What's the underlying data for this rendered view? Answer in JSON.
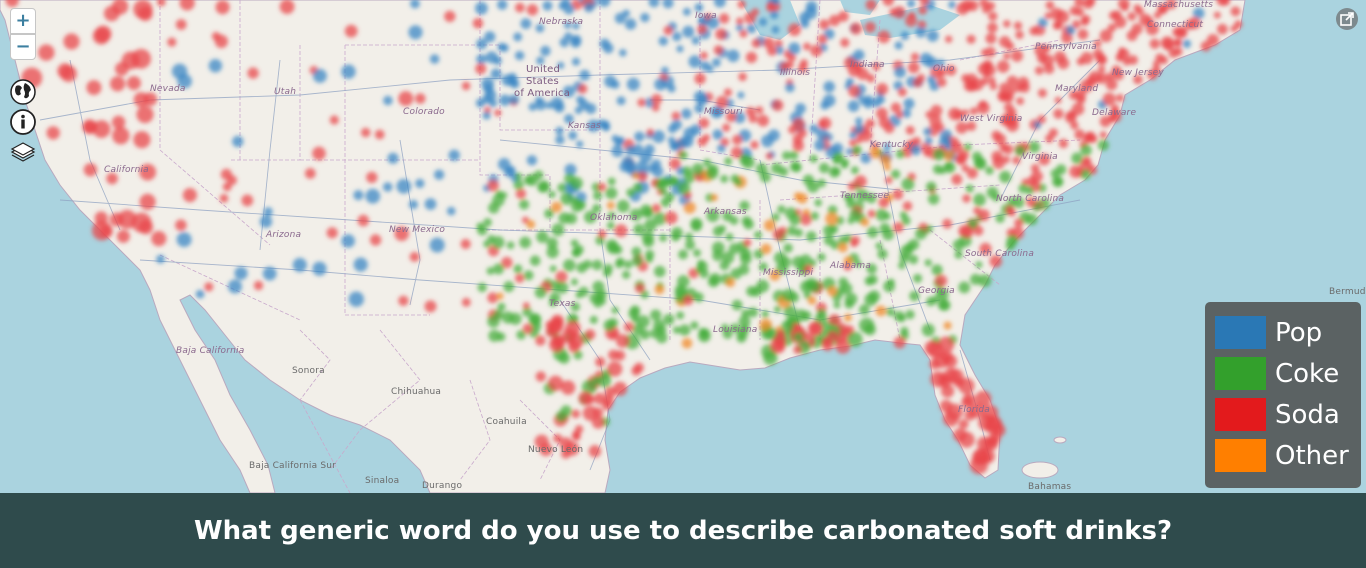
{
  "controls": {
    "zoom_in": "+",
    "zoom_out": "−"
  },
  "map_labels": {
    "nebraska": "Nebraska",
    "iowa": "Iowa",
    "massachusetts": "Massachusetts",
    "connecticut": "Connecticut",
    "nevada": "Nevada",
    "utah": "Utah",
    "usa_line1": "United",
    "usa_line2": "States",
    "usa_line3": "of America",
    "illinois": "Illinois",
    "indiana": "Indiana",
    "ohio": "Ohio",
    "pennsylvania": "Pennsylvania",
    "new_jersey": "New Jersey",
    "colorado": "Colorado",
    "kansas": "Kansas",
    "missouri": "Missouri",
    "maryland": "Maryland",
    "west_virginia": "West Virginia",
    "delaware": "Delaware",
    "california": "California",
    "kentucky": "Kentucky",
    "virginia": "Virginia",
    "tennessee": "Tennessee",
    "north_carolina": "North Carolina",
    "arkansas": "Arkansas",
    "oklahoma": "Oklahoma",
    "new_mexico": "New Mexico",
    "arizona": "Arizona",
    "south_carolina": "South Carolina",
    "mississippi": "Mississippi",
    "alabama": "Alabama",
    "georgia": "Georgia",
    "texas": "Texas",
    "louisiana": "Louisiana",
    "baja_california": "Baja California",
    "sonora": "Sonora",
    "chihuahua": "Chihuahua",
    "coahuila": "Coahuila",
    "nuevo_leon": "Nuevo León",
    "florida": "Florida",
    "baja_california_sur": "Baja California Sur",
    "sinaloa": "Sinaloa",
    "durango": "Durango",
    "bahamas": "Bahamas",
    "bermuda": "Bermud"
  },
  "legend": {
    "items": [
      {
        "label": "Pop",
        "color": "#2a78b5"
      },
      {
        "label": "Coke",
        "color": "#33a02c"
      },
      {
        "label": "Soda",
        "color": "#e31a1c"
      },
      {
        "label": "Other",
        "color": "#ff7f00"
      }
    ]
  },
  "footer": {
    "question": "What generic word do you use to describe carbonated soft drinks?"
  },
  "icons": {
    "globe": "globe-icon",
    "info": "info-icon",
    "layers": "layers-icon",
    "share": "share-icon"
  }
}
